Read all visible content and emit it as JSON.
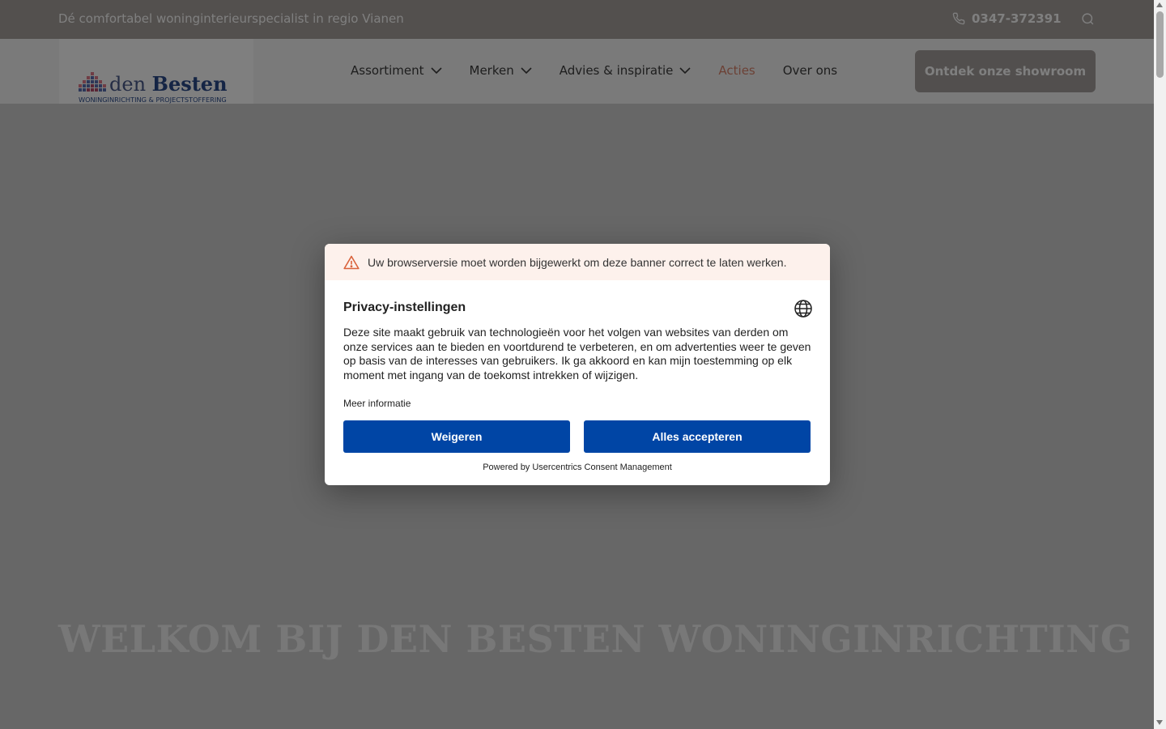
{
  "topbar": {
    "tagline": "Dé comfortabel woninginterieurspecialist in regio Vianen",
    "phone": "0347-372391",
    "phone_icon": "phone-icon",
    "search_icon": "search-icon"
  },
  "logo": {
    "brand": "den Besten",
    "subtitle": "WONINGINRICHTING & PROJECTSTOFFERING"
  },
  "nav": {
    "items": [
      {
        "label": "Assortiment",
        "has_dropdown": true
      },
      {
        "label": "Merken",
        "has_dropdown": true
      },
      {
        "label": "Advies & inspiratie",
        "has_dropdown": true
      },
      {
        "label": "Acties",
        "has_dropdown": false,
        "active": true
      },
      {
        "label": "Over ons",
        "has_dropdown": false
      }
    ],
    "cta": "Ontdek onze showroom"
  },
  "hero": {
    "title": "WELKOM BIJ DEN BESTEN WONINGINRICHTING"
  },
  "consent": {
    "warning": "Uw browserversie moet worden bijgewerkt om deze banner correct te laten werken.",
    "title": "Privacy-instellingen",
    "body": "Deze site maakt gebruik van technologieën voor het volgen van websites van derden om onze services aan te bieden en voortdurend te verbeteren, en om advertenties weer te geven op basis van de interesses van gebruikers. Ik ga akkoord en kan mijn toestemming op elk moment met ingang van de toekomst intrekken of wijzigen.",
    "more_info": "Meer informatie",
    "deny": "Weigeren",
    "accept": "Alles accepteren",
    "powered_by": "Powered by Usercentrics Consent Management"
  },
  "colors": {
    "topbar_bg": "#a6a09d",
    "cta_bg": "#a49f9c",
    "active_nav": "#d9826b",
    "button_blue": "#0045a5",
    "warning_bg": "#fdf1ec"
  }
}
